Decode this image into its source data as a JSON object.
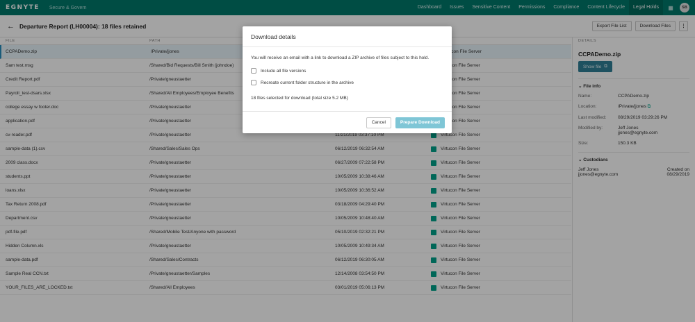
{
  "topbar": {
    "logo": "EGNYTE",
    "product": "Secure & Govern",
    "nav": [
      "Dashboard",
      "Issues",
      "Sensitive Content",
      "Permissions",
      "Compliance",
      "Content Lifecycle",
      "Legal Holds"
    ],
    "active_nav": "Legal Holds",
    "grid_icon": "grid-icon",
    "avatar": "SB"
  },
  "header": {
    "title": "Departure Report (LH00004): 18 files retained",
    "export_label": "Export File List",
    "download_label": "Download Files",
    "more_label": "⋮"
  },
  "table": {
    "columns": [
      "File",
      "Path"
    ],
    "rows": [
      {
        "file": "CCPADemo.zip",
        "path": "/Private/jjones",
        "date": "",
        "source": "Virtucon File Server"
      },
      {
        "file": "Sam test.msg",
        "path": "/Shared/Bid Requests/Bill Smith (johndoe)",
        "date": "",
        "source": "Virtucon File Server"
      },
      {
        "file": "Credit Report.pdf",
        "path": "/Private/gneustaetter",
        "date": "",
        "source": "Virtucon File Server"
      },
      {
        "file": "Payroll_test-dsars.xlsx",
        "path": "/Shared/All Employees/Employee Benefits",
        "date": "",
        "source": "Virtucon File Server"
      },
      {
        "file": "college essay w footer.doc",
        "path": "/Private/gneustaetter",
        "date": "",
        "source": "Virtucon File Server"
      },
      {
        "file": "application.pdf",
        "path": "/Private/gneustaetter",
        "date": "",
        "source": "Virtucon File Server"
      },
      {
        "file": "cv-reader.pdf",
        "path": "/Private/gneustaetter",
        "date": "11/21/2019 03:37:10 PM",
        "source": "Virtucon File Server"
      },
      {
        "file": "sample-data (1).csv",
        "path": "/Shared/Sales/Sales Ops",
        "date": "06/12/2019 06:32:54 AM",
        "source": "Virtucon File Server"
      },
      {
        "file": "2009 class.docx",
        "path": "/Private/gneustaetter",
        "date": "06/27/2009 07:22:58 PM",
        "source": "Virtucon File Server"
      },
      {
        "file": "students.ppt",
        "path": "/Private/gneustaetter",
        "date": "10/05/2009 10:38:46 AM",
        "source": "Virtucon File Server"
      },
      {
        "file": "loans.xlsx",
        "path": "/Private/gneustaetter",
        "date": "10/05/2009 10:36:52 AM",
        "source": "Virtucon File Server"
      },
      {
        "file": "Tax Return 2008.pdf",
        "path": "/Private/gneustaetter",
        "date": "03/18/2009 04:29:40 PM",
        "source": "Virtucon File Server"
      },
      {
        "file": "Department.csv",
        "path": "/Private/gneustaetter",
        "date": "10/05/2009 10:48:40 AM",
        "source": "Virtucon File Server"
      },
      {
        "file": "pdf-file.pdf",
        "path": "/Shared/Mobile Test/Anyone with password",
        "date": "05/10/2019 02:32:21 PM",
        "source": "Virtucon File Server"
      },
      {
        "file": "Hidden Column.xls",
        "path": "/Private/gneustaetter",
        "date": "10/05/2009 10:49:34 AM",
        "source": "Virtucon File Server"
      },
      {
        "file": "sample-data.pdf",
        "path": "/Shared/Sales/Contracts",
        "date": "06/12/2019 06:30:05 AM",
        "source": "Virtucon File Server"
      },
      {
        "file": "Sample Real CCN.txt",
        "path": "/Private/gneustaetter/Samples",
        "date": "12/14/2008 03:54:50 PM",
        "source": "Virtucon File Server"
      },
      {
        "file": "YOUR_FILES_ARE_LOCKED.txt",
        "path": "/Shared/All Employees",
        "date": "03/01/2019 05:06:13 PM",
        "source": "Virtucon File Server"
      }
    ]
  },
  "details": {
    "heading": "DETAILS",
    "file_name": "CCPADemo.zip",
    "show_file_label": "Show file",
    "file_info_title": "File info",
    "fields": [
      {
        "k": "Name:",
        "v": "CCPADemo.zip"
      },
      {
        "k": "Location:",
        "v": "/Private/jjones"
      },
      {
        "k": "Last modified:",
        "v": "08/29/2019 03:29:26 PM"
      },
      {
        "k": "Modified by:",
        "v": "Jeff Jones",
        "v2": "jjones@egnyte.com"
      },
      {
        "k": "Size:",
        "v": "150.3 KB"
      }
    ],
    "custodians_title": "Custodians",
    "custodian_name": "Jeff Jones",
    "custodian_email": "jjones@egnyte.com",
    "created_label": "Created on",
    "created_date": "08/29/2019"
  },
  "modal": {
    "title": "Download details",
    "message": "You will receive an email with a link to download a ZIP archive of files subject to this hold.",
    "option1": "Include all file versions",
    "option2": "Recreate current folder structure in the archive",
    "count_text": "18 files selected for download (total size 5.2 MB)",
    "cancel_label": "Cancel",
    "confirm_label": "Prepare Download"
  }
}
